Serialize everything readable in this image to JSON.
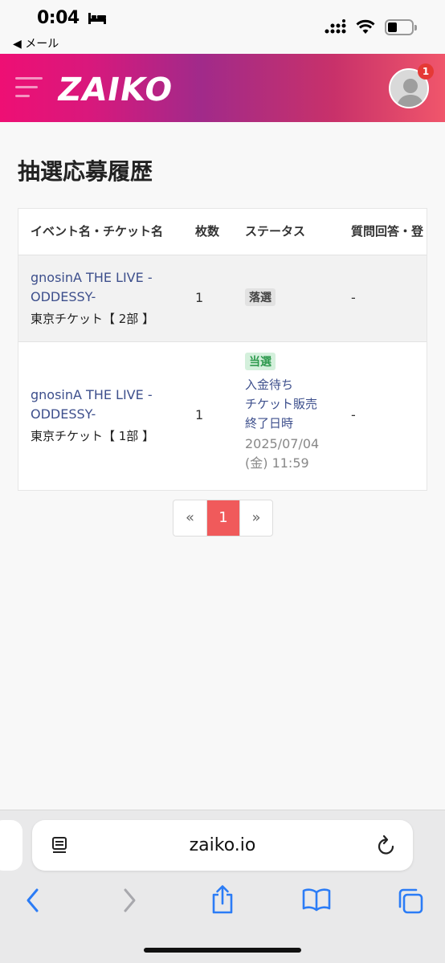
{
  "status_bar": {
    "time": "0:04",
    "back_label": "◀ メール"
  },
  "header": {
    "logo": "ZAIKO",
    "notification_count": "1"
  },
  "page": {
    "title": "抽選応募履歴"
  },
  "table": {
    "headers": [
      "イベント名・チケット名",
      "枚数",
      "ステータス",
      "質問回答・登"
    ],
    "rows": [
      {
        "event_line1": "gnosinA THE LIVE -",
        "event_line2": "ODDESSY-",
        "ticket": "東京チケット【 2部 】",
        "qty": "1",
        "status_label": "落選",
        "answer": "-"
      },
      {
        "event_line1": "gnosinA THE LIVE -",
        "event_line2": "ODDESSY-",
        "ticket": "東京チケット【 1部 】",
        "qty": "1",
        "status_label": "当選",
        "status_link": "入金待ち",
        "deadline_label_1": "チケット販売",
        "deadline_label_2": "終了日時",
        "deadline_date": "2025/07/04",
        "deadline_time": "(金) 11:59",
        "answer": "-"
      }
    ]
  },
  "pagination": {
    "prev": "«",
    "current": "1",
    "next": "»"
  },
  "browser": {
    "url": "zaiko.io"
  },
  "colors": {
    "accent": "#f05a5b",
    "link": "#3d4f8c",
    "win": "#2e9a4e"
  }
}
